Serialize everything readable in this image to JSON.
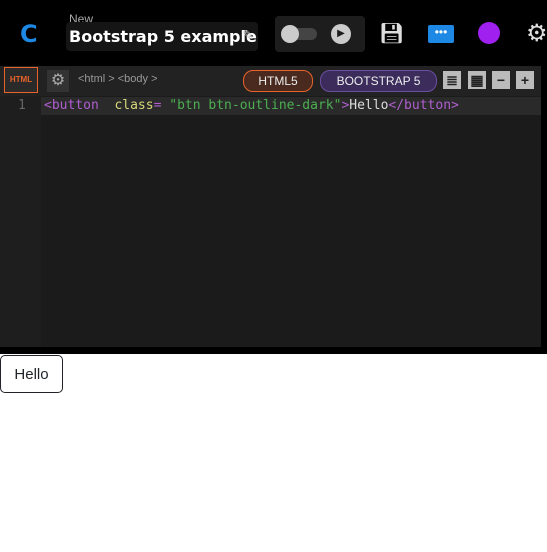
{
  "header": {
    "logo": "C",
    "subtitle": "New",
    "title": "Bootstrap 5 example"
  },
  "editor": {
    "badge": "HTML",
    "breadcrumb": "<html > <body >",
    "pills": [
      "HTML5",
      "BOOTSTRAP 5"
    ],
    "line_number": "1",
    "code": {
      "tag_open": "<button",
      "attr": "class",
      "eq": "=",
      "value": "\"btn btn-outline-dark\"",
      "gt": ">",
      "text": "Hello",
      "tag_close": "</button>"
    }
  },
  "preview": {
    "button_label": "Hello"
  },
  "colors": {
    "accent": "#1e88e5",
    "html": "#e8632a",
    "bootstrap": "#6a4fa0",
    "palette": "#a020f0"
  }
}
